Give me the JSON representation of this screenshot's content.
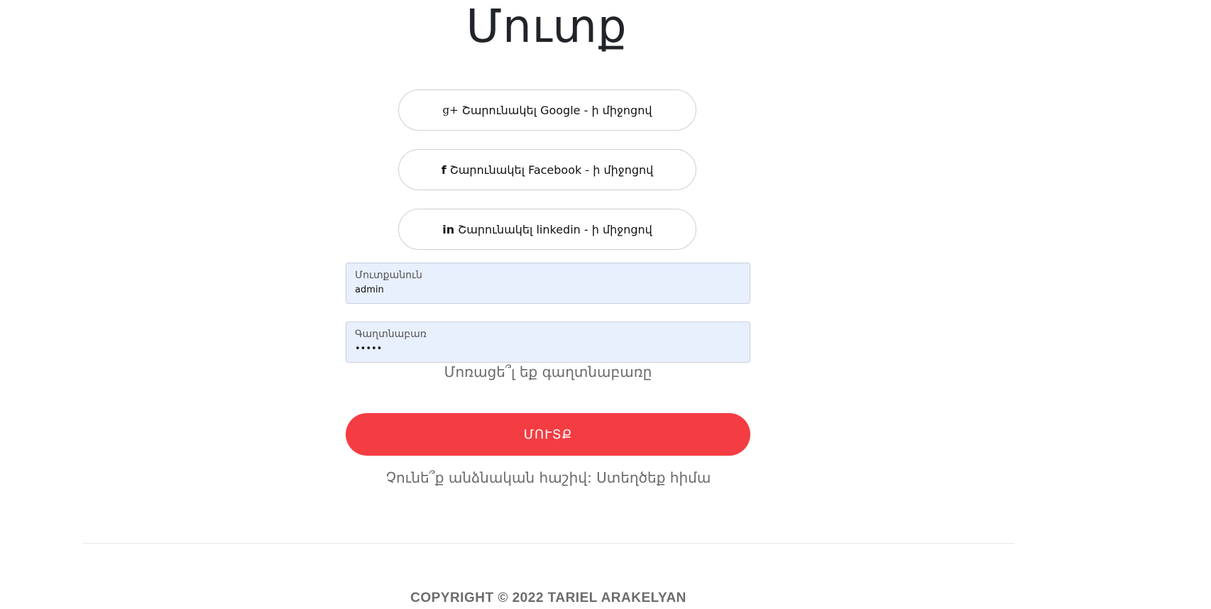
{
  "page": {
    "title": "Մուտք"
  },
  "social": {
    "google": {
      "icon": "google-plus-icon",
      "glyph": "g+",
      "label": "Շարունակել Google - ի միջոցով"
    },
    "facebook": {
      "icon": "facebook-icon",
      "glyph": "f",
      "label": "Շարունակել Facebook - ի միջոցով"
    },
    "linkedin": {
      "icon": "linkedin-icon",
      "glyph": "in",
      "label": "Շարունակել linkedin - ի միջոցով"
    }
  },
  "form": {
    "username": {
      "label": "Մուտքանուն",
      "value": "admin"
    },
    "password": {
      "label": "Գաղտնաբառ",
      "value": "•••••"
    },
    "forgot_link": "Մոռացե՞լ եք գաղտնաբառը",
    "submit_label": "ՄՈՒՏՔ",
    "submit_color": "#f43d42"
  },
  "signup": {
    "prompt": "Չունե՞ք անձնական հաշիվ:",
    "link": "Ստեղծեք հիմա"
  },
  "footer": {
    "copyright": "COPYRIGHT © 2022 TARIEL ARAKELYAN"
  }
}
